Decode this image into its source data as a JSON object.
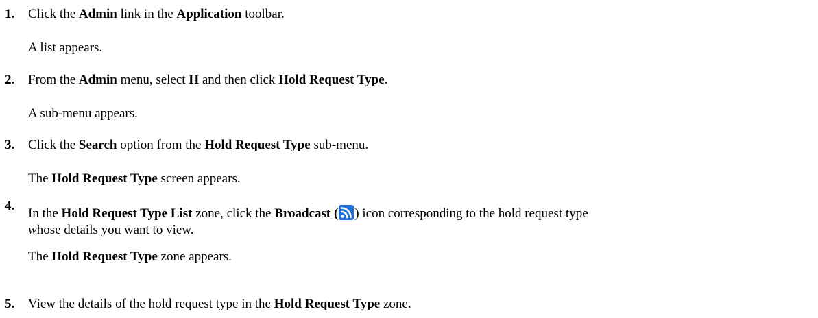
{
  "steps": [
    {
      "number": "1.",
      "parts": [
        "Click the ",
        "Admin",
        " link in the ",
        "Application",
        " toolbar."
      ],
      "result": "A list appears."
    },
    {
      "number": "2.",
      "parts": [
        "From the ",
        "Admin",
        " menu, select ",
        "H",
        " and then click ",
        "Hold Request Type",
        "."
      ],
      "result": "A sub-menu appears."
    },
    {
      "number": "3.",
      "parts": [
        "Click the ",
        "Search",
        " option from the ",
        "Hold Request Type",
        " sub-menu."
      ],
      "result_parts": [
        "The ",
        "Hold Request Type",
        " screen appears."
      ]
    },
    {
      "number": "4.",
      "parts": [
        "In the ",
        "Hold Request Type List",
        " zone, click the ",
        "Broadcast",
        " (",
        ") icon corresponding to the hold request type"
      ],
      "line2_parts": [
        "w",
        "hose details you want to view."
      ],
      "result_parts": [
        "The ",
        "Hold Request Type",
        " zone appears."
      ],
      "icon": "broadcast-icon",
      "icon_color": "#1e6fd6"
    },
    {
      "number": "5.",
      "parts": [
        "View the details of the hold request type in the ",
        "Hold Request Type",
        " zone."
      ]
    }
  ]
}
